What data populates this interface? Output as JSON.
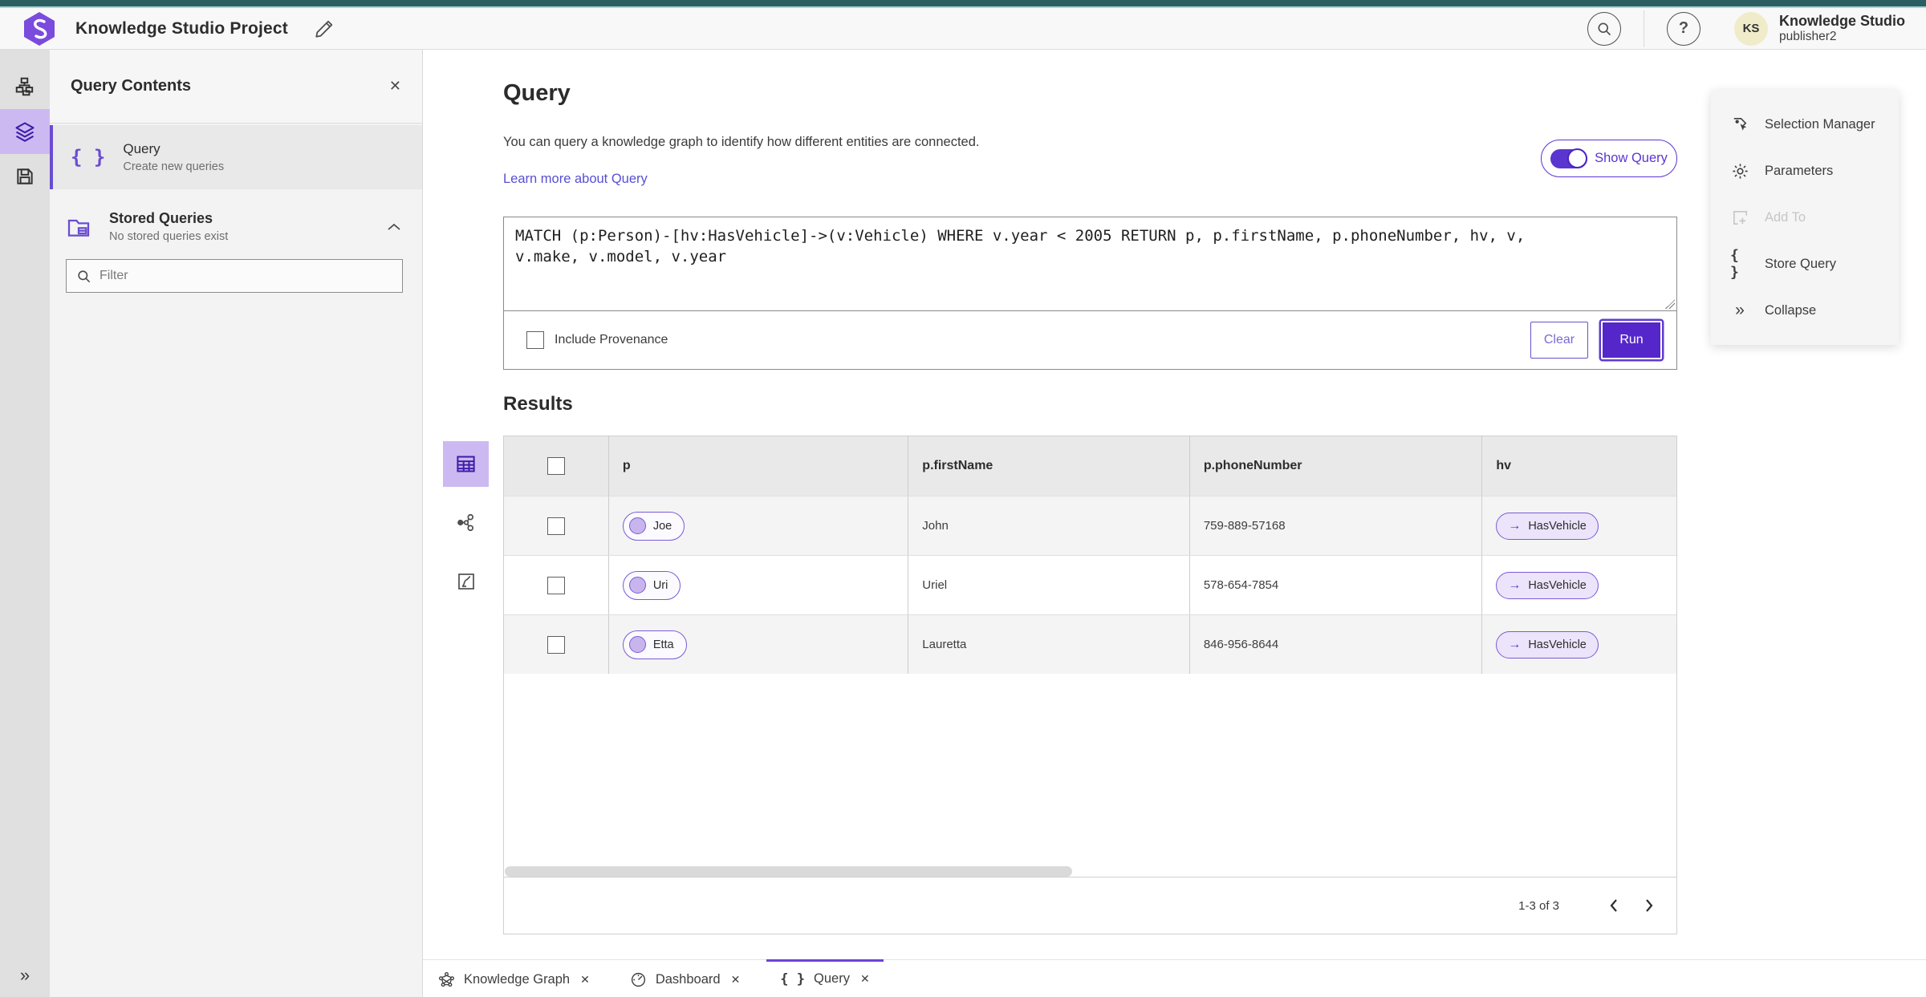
{
  "header": {
    "app_title": "Knowledge Studio Project",
    "user_name": "Knowledge Studio",
    "user_role": "publisher2",
    "avatar_initials": "KS",
    "help_glyph": "?"
  },
  "panel": {
    "title": "Query Contents",
    "query_item": {
      "title": "Query",
      "subtitle": "Create new queries"
    },
    "stored": {
      "title": "Stored Queries",
      "subtitle": "No stored queries exist"
    },
    "filter_placeholder": "Filter"
  },
  "query": {
    "heading": "Query",
    "description": "You can query a knowledge graph to identify how different entities are connected.",
    "learn_more": "Learn more about Query",
    "show_query_label": "Show Query",
    "query_text": "MATCH (p:Person)-[hv:HasVehicle]->(v:Vehicle) WHERE v.year < 2005 RETURN p, p.firstName, p.phoneNumber, hv, v,\nv.make, v.model, v.year",
    "include_provenance_label": "Include Provenance",
    "clear_label": "Clear",
    "run_label": "Run"
  },
  "results": {
    "heading": "Results",
    "columns": {
      "p": "p",
      "firstName": "p.firstName",
      "phoneNumber": "p.phoneNumber",
      "hv": "hv"
    },
    "rows": [
      {
        "p": "Joe",
        "firstName": "John",
        "phoneNumber": "759-889-57168",
        "hv": "HasVehicle"
      },
      {
        "p": "Uri",
        "firstName": "Uriel",
        "phoneNumber": "578-654-7854",
        "hv": "HasVehicle"
      },
      {
        "p": "Etta",
        "firstName": "Lauretta",
        "phoneNumber": "846-956-8644",
        "hv": "HasVehicle"
      }
    ],
    "pagination": "1-3 of 3"
  },
  "side_actions": {
    "selection_manager": "Selection Manager",
    "parameters": "Parameters",
    "add_to": "Add To",
    "store_query": "Store Query",
    "collapse": "Collapse"
  },
  "tabs": [
    {
      "label": "Knowledge Graph"
    },
    {
      "label": "Dashboard"
    },
    {
      "label": "Query"
    }
  ],
  "icons": {
    "braces": "{ }",
    "collapse_glyph": "»",
    "expand_glyph": "»",
    "close_glyph": "✕",
    "arrow_right": "→"
  },
  "colors": {
    "teal_bar": "#2a5f62",
    "primary_purple": "#5b35cf",
    "run_fill": "#5526c9",
    "lavender_selected": "#cdb9f2",
    "row_stripe": "#f4f4f4",
    "avatar_bg": "#f0ecca"
  }
}
